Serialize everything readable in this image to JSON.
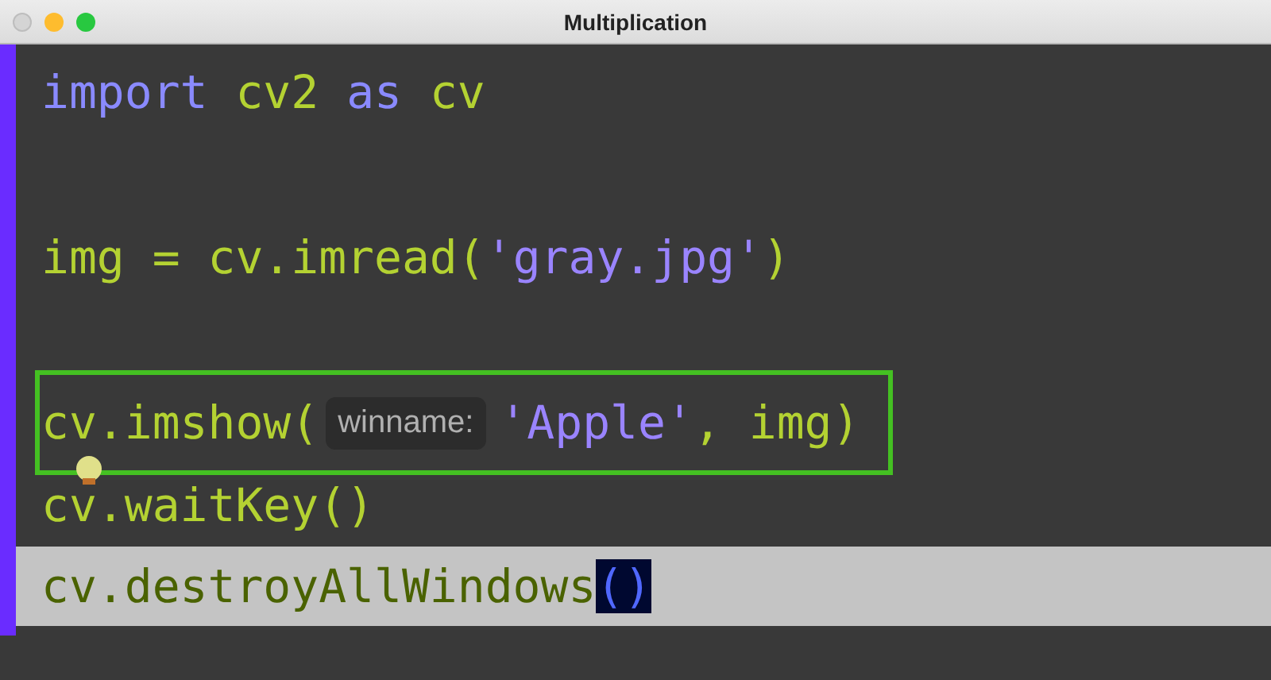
{
  "window": {
    "title": "Multiplication"
  },
  "lines": [
    {
      "kind": "code",
      "boxed": false,
      "current": false,
      "parts": [
        {
          "kind": "keyword",
          "text": "import"
        },
        {
          "kind": "plain",
          "text": " cv2 "
        },
        {
          "kind": "keyword",
          "text": "as"
        },
        {
          "kind": "plain",
          "text": " cv"
        }
      ]
    },
    {
      "kind": "blank"
    },
    {
      "kind": "code",
      "boxed": false,
      "current": false,
      "parts": [
        {
          "kind": "plain",
          "text": "img = cv.imread("
        },
        {
          "kind": "string",
          "text": "'gray.jpg'"
        },
        {
          "kind": "plain",
          "text": ")"
        }
      ]
    },
    {
      "kind": "blank"
    },
    {
      "kind": "code",
      "boxed": true,
      "current": false,
      "parts": [
        {
          "kind": "plain",
          "text": "cv.imshow("
        },
        {
          "kind": "hint",
          "text": "winname:"
        },
        {
          "kind": "string",
          "text": "'Apple'"
        },
        {
          "kind": "plain",
          "text": ", img)"
        }
      ]
    },
    {
      "kind": "code",
      "boxed": false,
      "current": false,
      "bulb": true,
      "parts": [
        {
          "kind": "plain",
          "text": "cv.waitKey()"
        }
      ]
    },
    {
      "kind": "code",
      "boxed": false,
      "current": true,
      "parts": [
        {
          "kind": "plain",
          "text": "cv.destroyAllWindows"
        },
        {
          "kind": "match",
          "text": "()"
        }
      ]
    }
  ]
}
